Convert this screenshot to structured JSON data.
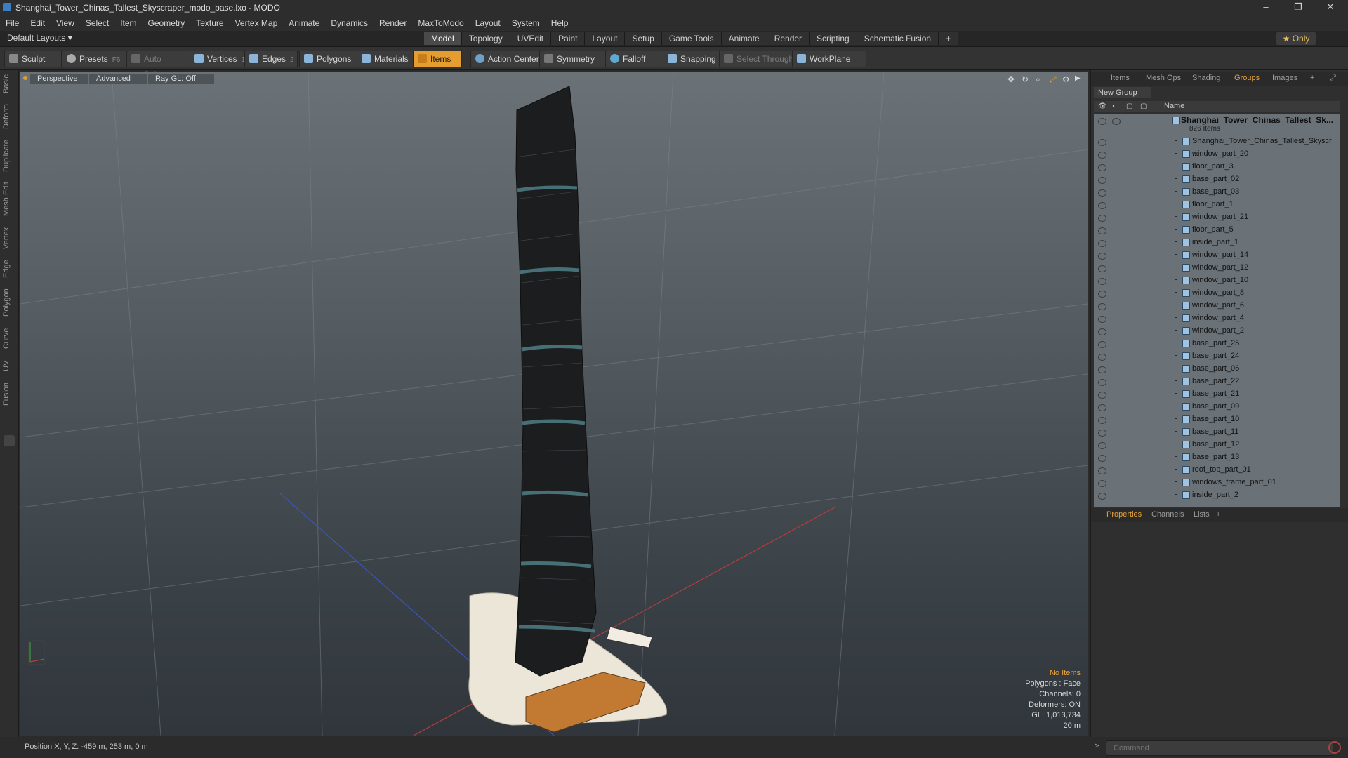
{
  "window": {
    "title": "Shanghai_Tower_Chinas_Tallest_Skyscraper_modo_base.lxo - MODO",
    "controls": {
      "minimize": "–",
      "restore": "❐",
      "close": "✕"
    }
  },
  "menu": [
    "File",
    "Edit",
    "View",
    "Select",
    "Item",
    "Geometry",
    "Texture",
    "Vertex Map",
    "Animate",
    "Dynamics",
    "Render",
    "MaxToModo",
    "Layout",
    "System",
    "Help"
  ],
  "layout_selector": "Default Layouts ▾",
  "layout_tabs": [
    "Model",
    "Topology",
    "UVEdit",
    "Paint",
    "Layout",
    "Setup",
    "Game Tools",
    "Animate",
    "Render",
    "Scripting",
    "Schematic Fusion",
    "+"
  ],
  "active_tab": "Model",
  "only_button": "★  Only",
  "toolbar": {
    "sculpt": "Sculpt",
    "presets": "Presets",
    "presets_key": "F6",
    "auto_select": "Auto Select",
    "vertices": "Vertices",
    "vertices_num": "1",
    "edges": "Edges",
    "edges_num": "2",
    "polygons": "Polygons",
    "materials": "Materials",
    "items": "Items",
    "action_center": "Action Center",
    "symmetry": "Symmetry",
    "falloff": "Falloff",
    "snapping": "Snapping",
    "select_through": "Select Through",
    "workplane": "WorkPlane"
  },
  "left_tabs": [
    "Basic",
    "Deform",
    "Duplicate",
    "Mesh Edit",
    "Vertex",
    "Edge",
    "Polygon",
    "Curve",
    "UV",
    "Fusion"
  ],
  "viewport": {
    "view_mode": "Perspective",
    "shading": "Advanced",
    "raygl": "Ray GL: Off",
    "info": {
      "items": "No Items",
      "polygons": "Polygons : Face",
      "channels": "Channels: 0",
      "deformers": "Deformers: ON",
      "gl": "GL: 1,013,734",
      "scale": "20 m"
    }
  },
  "right_panel": {
    "tabs": [
      "Items",
      "Mesh Ops",
      "Shading",
      "Groups",
      "Images",
      "+"
    ],
    "active_tab": "Groups",
    "new_group": "New Group",
    "column_name": "Name",
    "root": {
      "label": "Shanghai_Tower_Chinas_Tallest_Sk...",
      "count": "826 Items"
    },
    "items": [
      "Shanghai_Tower_Chinas_Tallest_Skyscr ...",
      "window_part_20",
      "floor_part_3",
      "base_part_02",
      "base_part_03",
      "floor_part_1",
      "window_part_21",
      "floor_part_5",
      "inside_part_1",
      "window_part_14",
      "window_part_12",
      "window_part_10",
      "window_part_8",
      "window_part_6",
      "window_part_4",
      "window_part_2",
      "base_part_25",
      "base_part_24",
      "base_part_06",
      "base_part_22",
      "base_part_21",
      "base_part_09",
      "base_part_10",
      "base_part_11",
      "base_part_12",
      "base_part_13",
      "roof_top_part_01",
      "windows_frame_part_01",
      "inside_part_2"
    ],
    "bottom_tabs": [
      "Properties",
      "Channels",
      "Lists",
      "+"
    ],
    "bottom_active": "Properties"
  },
  "status": {
    "position": "Position X, Y, Z:   -459 m, 253 m, 0 m"
  },
  "command": {
    "prompt": ">",
    "placeholder": "Command"
  },
  "colors": {
    "accent": "#e59d2f",
    "tree_bg": "#6a7278",
    "viewport_top": "#6b7277"
  }
}
